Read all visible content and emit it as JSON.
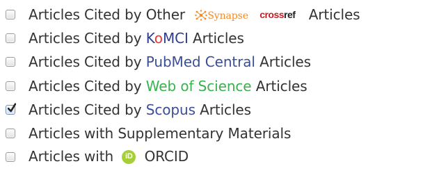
{
  "filters": [
    {
      "checked": false,
      "prefix": "Articles Cited by Other",
      "logos": {
        "synapse": "Synapse",
        "synapse_small": "",
        "crossref_cross": "cross",
        "crossref_ref": "ref"
      },
      "suffix": "Articles"
    },
    {
      "checked": false,
      "prefix": "Articles Cited by",
      "source_part_1": "K",
      "source_part_2": "o",
      "source_part_3": "MCI",
      "suffix": "Articles"
    },
    {
      "checked": false,
      "prefix": "Articles Cited by",
      "source": "PubMed Central",
      "suffix": "Articles"
    },
    {
      "checked": false,
      "prefix": "Articles Cited by",
      "source": "Web of Science",
      "suffix": "Articles"
    },
    {
      "checked": true,
      "prefix": "Articles Cited by",
      "source": "Scopus",
      "suffix": "Articles"
    },
    {
      "checked": false,
      "label": "Articles with Supplementary Materials"
    },
    {
      "checked": false,
      "prefix": "Articles with",
      "logo_text": "iD",
      "suffix": "ORCID"
    }
  ],
  "colors": {
    "text": "#333333",
    "source_blue": "#3b4e98",
    "source_green": "#37b24d",
    "source_red": "#e53935",
    "synapse_orange": "#f28c28",
    "crossref_red": "#c31f26",
    "orcid_green": "#a6ce39"
  },
  "icons": {
    "checkbox": "checkbox-icon",
    "checkmark": "checkmark-icon",
    "synapse": "synapse-logo-icon",
    "crossref": "crossref-logo-icon",
    "orcid": "orcid-logo-icon"
  }
}
